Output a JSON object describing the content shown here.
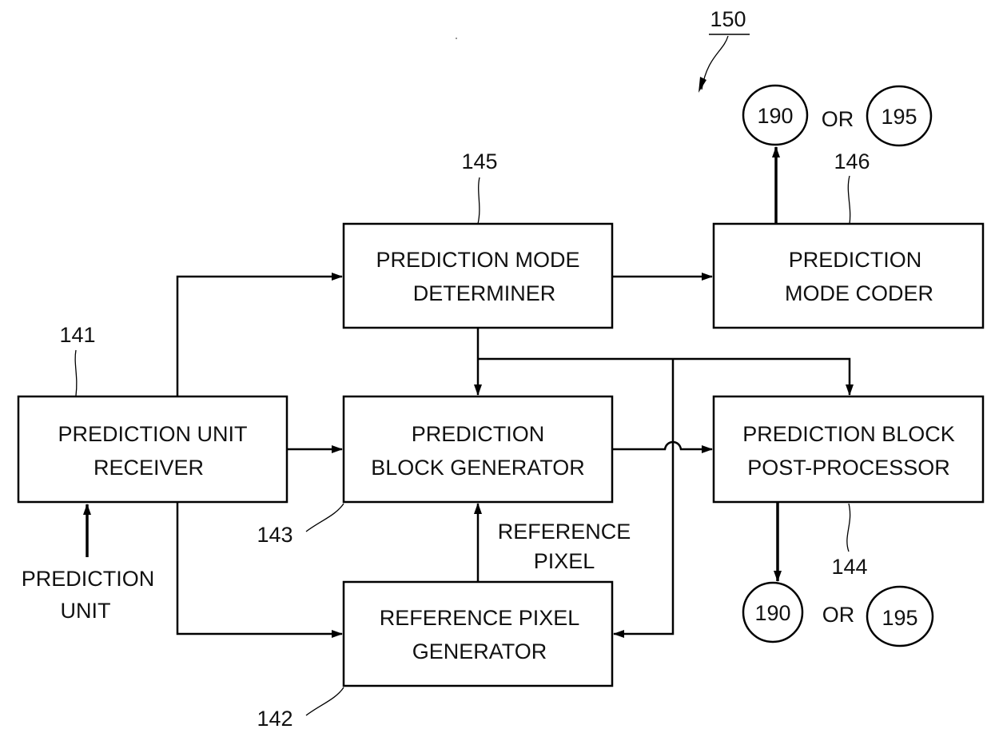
{
  "figure": {
    "ref_number": "150",
    "blocks": {
      "receiver": {
        "ref": "141",
        "line1": "PREDICTION UNIT",
        "line2": "RECEIVER"
      },
      "mode_determiner": {
        "ref": "145",
        "line1": "PREDICTION MODE",
        "line2": "DETERMINER"
      },
      "mode_coder": {
        "ref": "146",
        "line1": "PREDICTION",
        "line2": "MODE CODER"
      },
      "block_generator": {
        "ref": "143",
        "line1": "PREDICTION",
        "line2": "BLOCK GENERATOR"
      },
      "post_processor": {
        "ref": "144",
        "line1": "PREDICTION BLOCK",
        "line2": "POST-PROCESSOR"
      },
      "ref_pixel_generator": {
        "ref": "142",
        "line1": "REFERENCE PIXEL",
        "line2": "GENERATOR"
      }
    },
    "input_label": {
      "line1": "PREDICTION",
      "line2": "UNIT"
    },
    "reference_pixel_label": {
      "line1": "REFERENCE",
      "line2": "PIXEL"
    },
    "outputs_top": {
      "a": "190",
      "or": "OR",
      "b": "195"
    },
    "outputs_bottom": {
      "a": "190",
      "or": "OR",
      "b": "195"
    }
  }
}
